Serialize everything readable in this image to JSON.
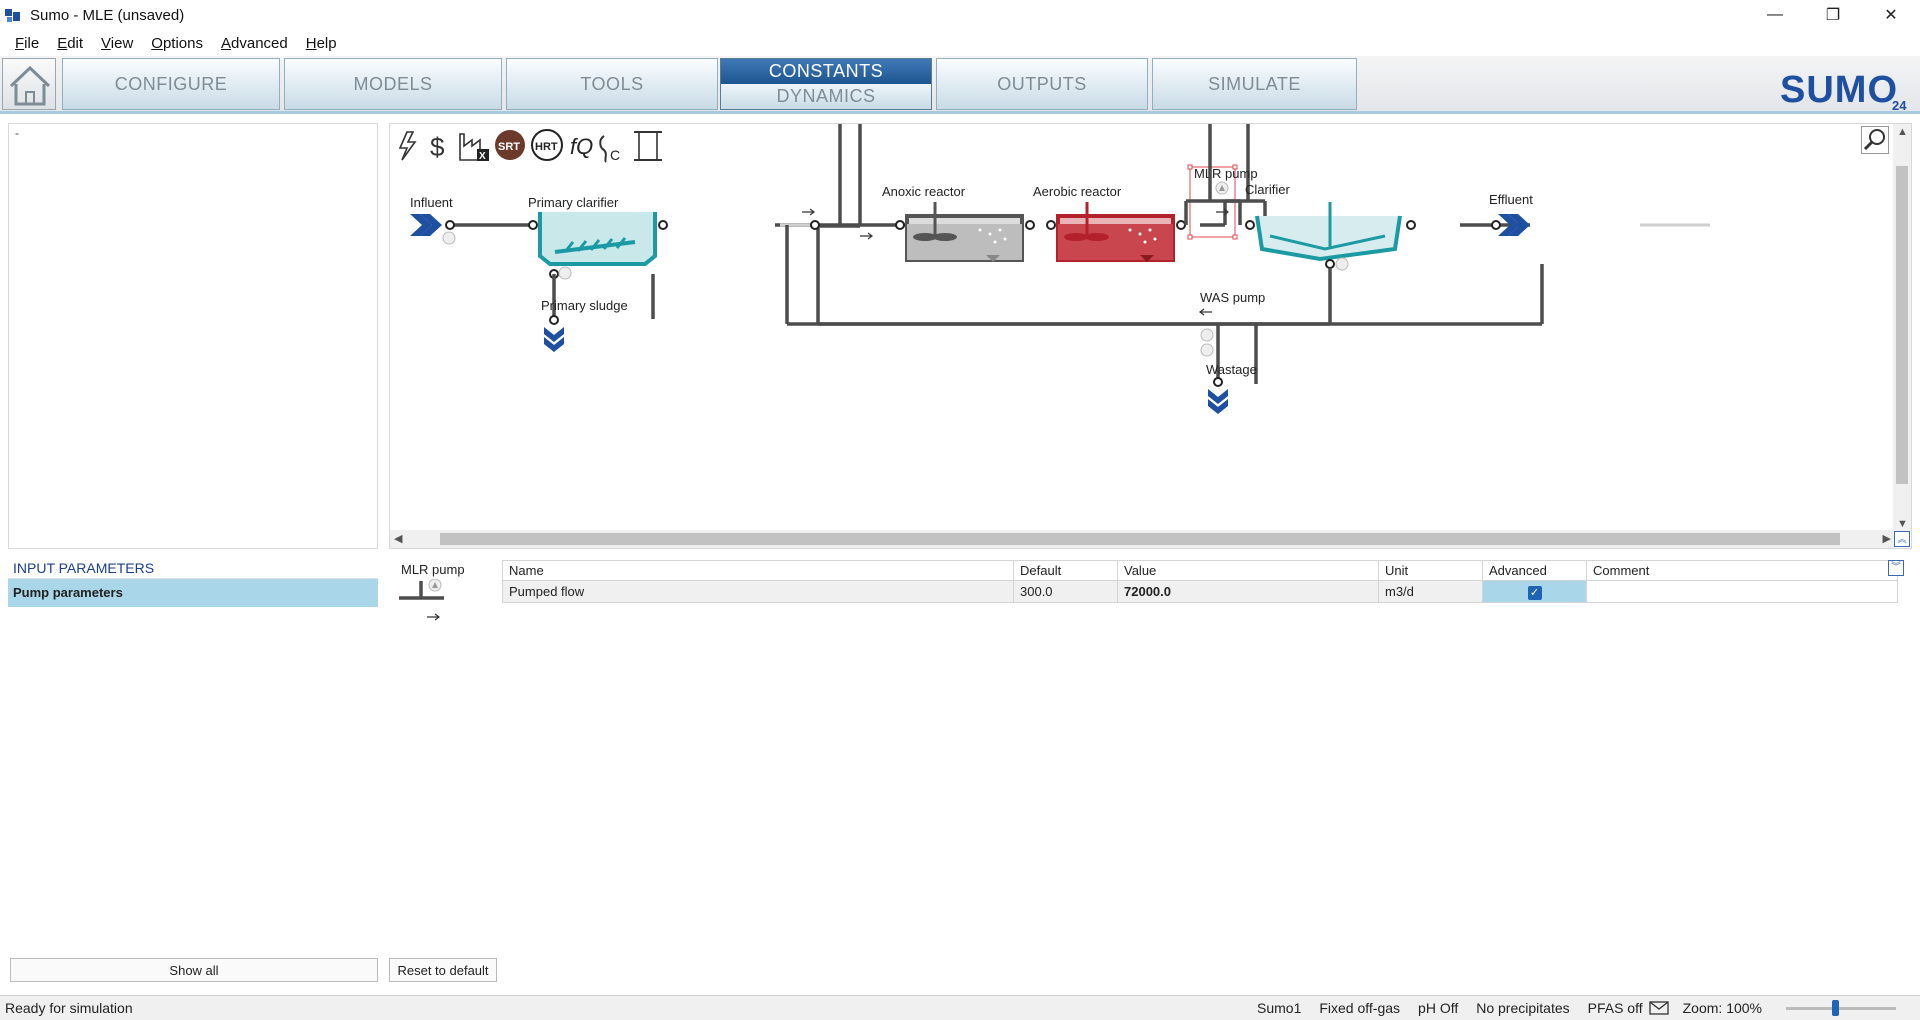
{
  "window": {
    "title": "Sumo - MLE (unsaved)",
    "minimize": "—",
    "restore": "❐",
    "close": "✕"
  },
  "menu": [
    {
      "label": "File",
      "key": "F"
    },
    {
      "label": "Edit",
      "key": "E"
    },
    {
      "label": "View",
      "key": "V"
    },
    {
      "label": "Options",
      "key": "O"
    },
    {
      "label": "Advanced",
      "key": "A"
    },
    {
      "label": "Help",
      "key": "H"
    }
  ],
  "tabs": {
    "configure": "CONFIGURE",
    "models": "MODELS",
    "tools": "TOOLS",
    "constants": "CONSTANTS",
    "dynamics": "DYNAMICS",
    "outputs": "OUTPUTS",
    "simulate": "SIMULATE"
  },
  "logo": {
    "text": "SUMO",
    "version": "24"
  },
  "tree": {
    "root": "-"
  },
  "toolbar_icons": [
    "lightning-icon",
    "dollar-icon",
    "factory-cost-icon",
    "srt-icon",
    "hrt-icon",
    "function-q-icon",
    "footprint-c-icon",
    "scroll-icon"
  ],
  "toolbar_labels": {
    "srt": "SRT",
    "hrt": "HRT",
    "fq": "fQ",
    "c": "C"
  },
  "flowsheet": {
    "units": {
      "influent": "Influent",
      "primary_clarifier": "Primary clarifier",
      "primary_sludge": "Primary sludge",
      "anoxic_reactor": "Anoxic reactor",
      "aerobic_reactor": "Aerobic reactor",
      "mlr_pump": "MLR pump",
      "clarifier": "Clarifier",
      "effluent": "Effluent",
      "was_pump": "WAS pump",
      "wastage": "Wastage"
    }
  },
  "input_parameters": {
    "title": "INPUT PARAMETERS",
    "selected_group": "Pump parameters",
    "unit_label": "MLR pump",
    "columns": [
      "Name",
      "Default",
      "Value",
      "Unit",
      "Advanced",
      "Comment"
    ],
    "rows": [
      {
        "name": "Pumped flow",
        "default": "300.0",
        "value": "72000.0",
        "unit": "m3/d",
        "advanced": true,
        "comment": ""
      }
    ]
  },
  "buttons": {
    "show_all": "Show all",
    "reset_to_default": "Reset to default"
  },
  "status": {
    "left": "Ready for simulation",
    "items": [
      "Sumo1",
      "Fixed off-gas",
      "pH Off",
      "No precipitates",
      "PFAS off"
    ],
    "zoom": "Zoom: 100%"
  },
  "colors": {
    "active_tab": "#1e5590",
    "clarifier_teal": "#1c9aa4",
    "anoxic_gray": "#888888",
    "aerobic_red": "#b3212a",
    "selection_red": "#e0484f",
    "brand_blue": "#1e4fa0"
  }
}
